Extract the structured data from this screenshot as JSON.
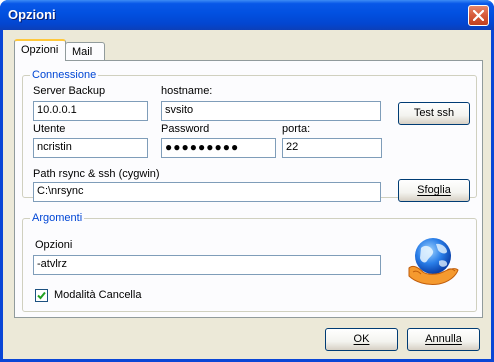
{
  "window": {
    "title": "Opzioni"
  },
  "tabs": [
    {
      "label": "Opzioni",
      "active": true
    },
    {
      "label": "Mail",
      "active": false
    }
  ],
  "connessione": {
    "group_label": "Connessione",
    "server_backup": {
      "label": "Server Backup",
      "value": "10.0.0.1"
    },
    "hostname": {
      "label": "hostname:",
      "value": "svsito"
    },
    "utente": {
      "label": "Utente",
      "value": "ncristin"
    },
    "password": {
      "label": "Password",
      "value": "●●●●●●●●●"
    },
    "porta": {
      "label": "porta:",
      "value": "22"
    },
    "path": {
      "label": "Path rsync & ssh (cygwin)",
      "value": "C:\\nrsync"
    },
    "test_button": "Test ssh",
    "browse_button": "Sfoglia"
  },
  "argomenti": {
    "group_label": "Argomenti",
    "opzioni": {
      "label": "Opzioni",
      "value": "-atvlrz"
    },
    "modalita_cancella": {
      "label": "Modalità Cancella",
      "checked": true
    }
  },
  "footer": {
    "ok_button": "OK",
    "cancel_button": "Annulla"
  },
  "colors": {
    "title_bar": "#0250e0",
    "group_label": "#0046d5",
    "dialog_bg": "#ece9d8"
  }
}
